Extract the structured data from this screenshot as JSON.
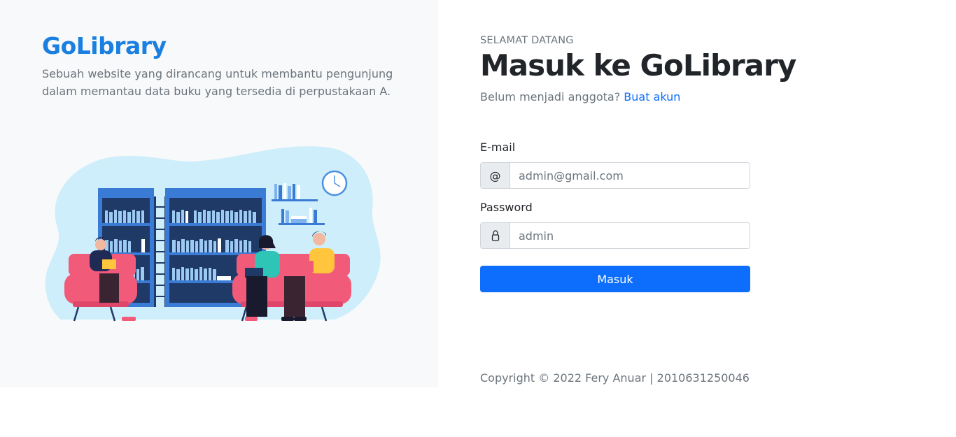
{
  "brand": {
    "name": "GoLibrary",
    "color": "#1a7fe0"
  },
  "intro": {
    "tagline": "Sebuah website yang dirancang untuk membantu pengunjung dalam memantau data buku yang tersedia di perpustakaan A."
  },
  "login": {
    "welcome": "SELAMAT DATANG",
    "title": "Masuk ke GoLibrary",
    "signup_prompt": "Belum menjadi anggota?",
    "signup_link": "Buat akun",
    "email": {
      "label": "E-mail",
      "addon": "@",
      "value": "admin@gmail.com"
    },
    "password": {
      "label": "Password",
      "addon_icon": "lock-icon",
      "value": "admin"
    },
    "submit_label": "Masuk",
    "accent_color": "#0d6efd"
  },
  "footer": {
    "copyright": "Copyright © 2022 Fery Anuar | 2010631250046"
  }
}
